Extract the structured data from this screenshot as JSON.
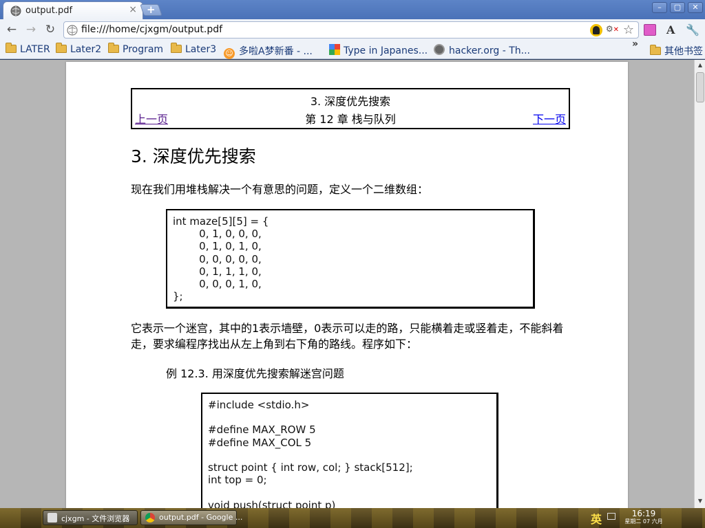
{
  "tab": {
    "title": "output.pdf",
    "close": "×",
    "new_tab": "+"
  },
  "window_buttons": {
    "minimize": "–",
    "maximize": "▢",
    "close": "✕"
  },
  "toolbar": {
    "back": "←",
    "forward": "→",
    "reload": "↻",
    "url": "file:///home/cjxgm/output.pdf",
    "star": "☆",
    "font": "A",
    "wrench": "🔧"
  },
  "bookmarks": {
    "items": [
      {
        "label": "LATER",
        "icon": "folder-icon"
      },
      {
        "label": "Later2",
        "icon": "folder-icon"
      },
      {
        "label": "Program",
        "icon": "folder-icon"
      },
      {
        "label": "Later3",
        "icon": "folder-icon"
      },
      {
        "label": "多啦A梦新番 - ...",
        "icon": "smiley-icon"
      },
      {
        "label": "Type in Japanes...",
        "icon": "google-icon"
      },
      {
        "label": "hacker.org - Th...",
        "icon": "globe-icon"
      }
    ],
    "overflow": "»",
    "other": "其他书签"
  },
  "pdf": {
    "nav": {
      "section": "3. 深度优先搜索",
      "prev": "上一页",
      "chapter": "第 12 章 栈与队列",
      "next": "下一页"
    },
    "heading": "3. 深度优先搜索",
    "intro": "现在我们用堆栈解决一个有意思的问题，定义一个二维数组：",
    "maze_code": "int maze[5][5] = {\n        0, 1, 0, 0, 0,\n        0, 1, 0, 1, 0,\n        0, 0, 0, 0, 0,\n        0, 1, 1, 1, 0,\n        0, 0, 0, 1, 0,\n};",
    "description": "它表示一个迷宫，其中的1表示墙壁，0表示可以走的路，只能横着走或竖着走，不能斜着走，要求编程序找出从左上角到右下角的路线。程序如下：",
    "example_caption": "例 12.3. 用深度优先搜索解迷宫问题",
    "program_code": "#include <stdio.h>\n\n#define MAX_ROW 5\n#define MAX_COL 5\n\nstruct point { int row, col; } stack[512];\nint top = 0;\n\nvoid push(struct point p)"
  },
  "taskbar": {
    "buttons": [
      {
        "label": "cjxgm - 文件浏览器",
        "active": false
      },
      {
        "label": "output.pdf - Google ...",
        "active": true
      }
    ],
    "ime": "英",
    "time": "16:19",
    "date": "星期二 07 六月"
  }
}
